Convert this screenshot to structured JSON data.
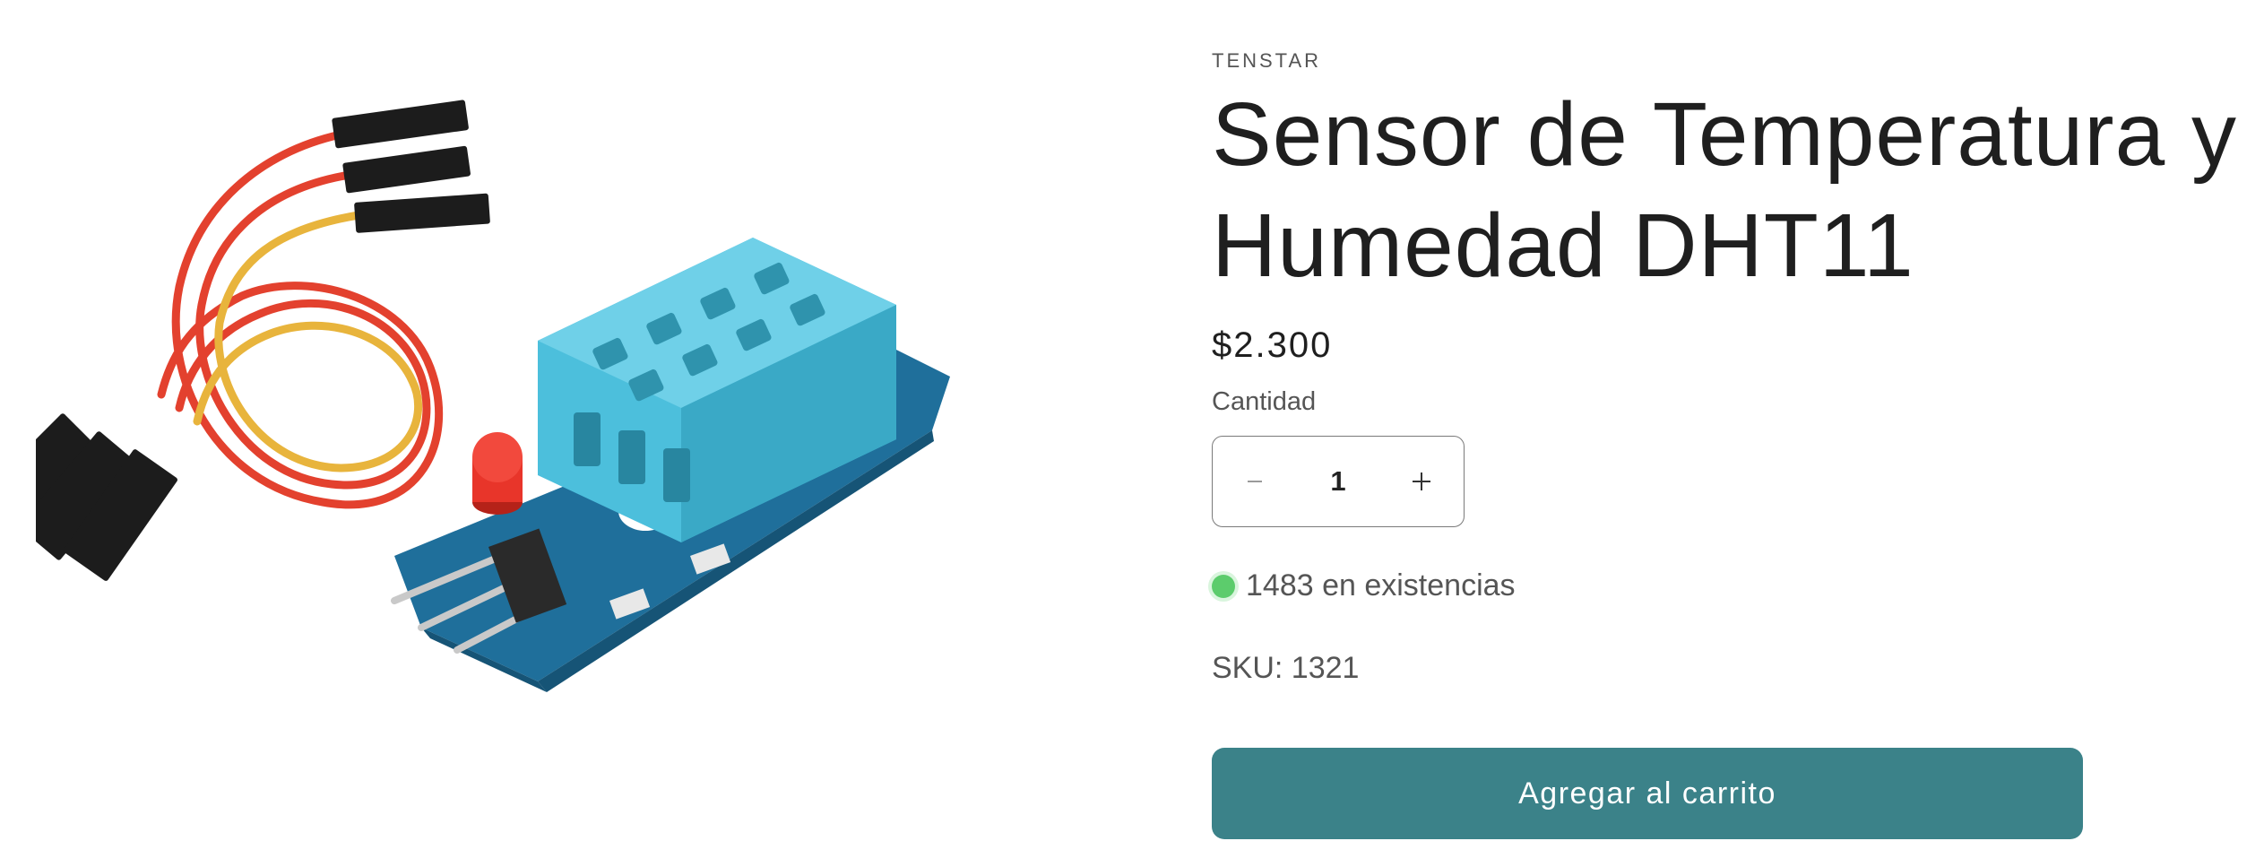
{
  "product": {
    "vendor": "TENSTAR",
    "title": "Sensor de Temperatura y Humedad DHT11",
    "price": "$2.300",
    "quantity_label": "Cantidad",
    "quantity_value": "1",
    "stock_text": "1483 en existencias",
    "sku_text": "SKU: 1321",
    "add_to_cart_label": "Agregar al carrito",
    "image_icon": "dht11-sensor-module-photo"
  },
  "icons": {
    "decrease": "minus-icon",
    "increase": "plus-icon",
    "stock": "in-stock-dot-icon"
  },
  "colors": {
    "accent": "#3b8289",
    "stock_indicator": "#5ccc6c",
    "sensor_body": "#4cbfdc",
    "pcb": "#1f6f9b",
    "led": "#e8352a"
  }
}
